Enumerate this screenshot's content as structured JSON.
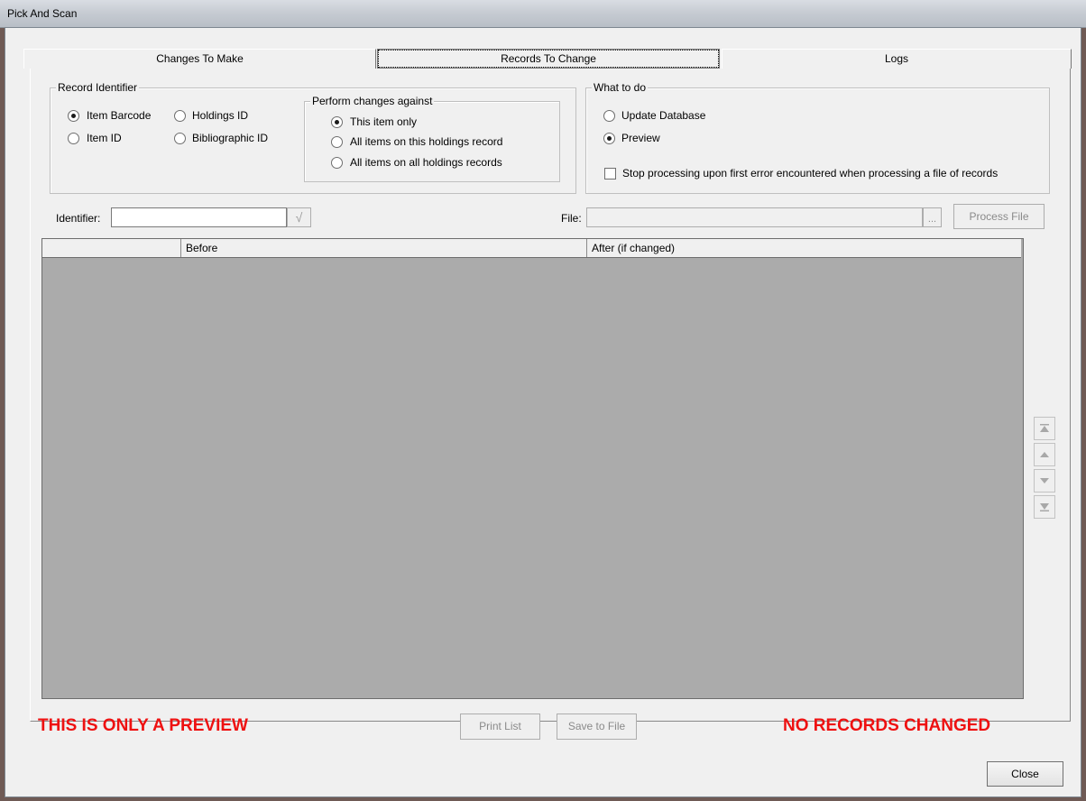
{
  "window": {
    "title": "Pick And Scan"
  },
  "tabs": [
    {
      "label": "Changes To Make",
      "active": false
    },
    {
      "label": "Records To Change",
      "active": true
    },
    {
      "label": "Logs",
      "active": false
    }
  ],
  "record_identifier": {
    "legend": "Record Identifier",
    "options": [
      {
        "label": "Item Barcode",
        "selected": true
      },
      {
        "label": "Holdings ID",
        "selected": false
      },
      {
        "label": "Item ID",
        "selected": false
      },
      {
        "label": "Bibliographic ID",
        "selected": false
      }
    ]
  },
  "perform_changes": {
    "legend": "Perform changes against",
    "options": [
      {
        "label": "This item only",
        "selected": true
      },
      {
        "label": "All items on this holdings record",
        "selected": false
      },
      {
        "label": "All items on all holdings records",
        "selected": false
      }
    ]
  },
  "what_to_do": {
    "legend": "What to do",
    "options": [
      {
        "label": "Update Database",
        "selected": false
      },
      {
        "label": "Preview",
        "selected": true
      }
    ],
    "stop_on_error_label": "Stop processing upon first error encountered when processing a file of records",
    "stop_on_error_checked": false
  },
  "identifier": {
    "label": "Identifier:",
    "value": "",
    "go_glyph": "√"
  },
  "file": {
    "label": "File:",
    "value": "",
    "browse_label": "...",
    "process_label": "Process File"
  },
  "grid": {
    "columns": [
      "",
      "Before",
      "After (if changed)"
    ]
  },
  "footer": {
    "preview_warning": "THIS IS ONLY A PREVIEW",
    "print_label": "Print List",
    "save_label": "Save to File",
    "status": "NO RECORDS CHANGED",
    "close_label": "Close"
  },
  "colors": {
    "alert": "#ee1111",
    "grid_bg": "#ababab",
    "window_bg": "#f0f0f0"
  },
  "icons": [
    "move-first-icon",
    "move-up-icon",
    "move-down-icon",
    "move-last-icon"
  ]
}
